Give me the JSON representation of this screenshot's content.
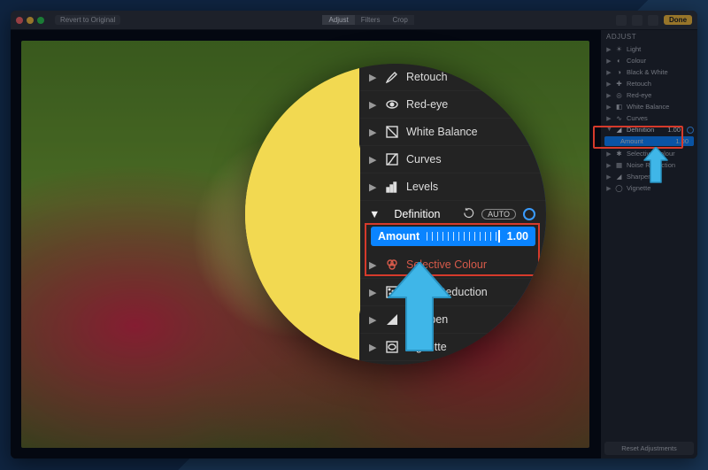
{
  "toolbar": {
    "revert": "Revert to Original",
    "mode": {
      "adjust": "Adjust",
      "filters": "Filters",
      "crop": "Crop"
    },
    "done": "Done"
  },
  "inspector": {
    "header": "ADJUST",
    "items": [
      {
        "label": "Light"
      },
      {
        "label": "Colour"
      },
      {
        "label": "Black & White"
      },
      {
        "label": "Retouch"
      },
      {
        "label": "Red-eye"
      },
      {
        "label": "White Balance"
      },
      {
        "label": "Curves"
      }
    ],
    "definition": {
      "label": "Definition",
      "value": "1.00",
      "amount_label": "Amount",
      "amount_value": "1.00"
    },
    "rest": [
      {
        "label": "Selective Colour"
      },
      {
        "label": "Noise Reduction"
      },
      {
        "label": "Sharpen"
      },
      {
        "label": "Vignette"
      }
    ],
    "reset": "Reset Adjustments"
  },
  "lens": {
    "items_top": [
      {
        "label": "Retouch",
        "icon": "retouch"
      },
      {
        "label": "Red-eye",
        "icon": "redeye"
      },
      {
        "label": "White Balance",
        "icon": "wb"
      },
      {
        "label": "Curves",
        "icon": "curves"
      },
      {
        "label": "Levels",
        "icon": "levels"
      }
    ],
    "definition": {
      "label": "Definition",
      "auto": "AUTO",
      "amount_label": "Amount",
      "amount_value": "1.00"
    },
    "items_bottom": [
      {
        "label": "Selective Colour",
        "sel": true
      },
      {
        "label": "Noise Reduction"
      },
      {
        "label": "Sharpen"
      },
      {
        "label": "Vignette"
      }
    ]
  }
}
